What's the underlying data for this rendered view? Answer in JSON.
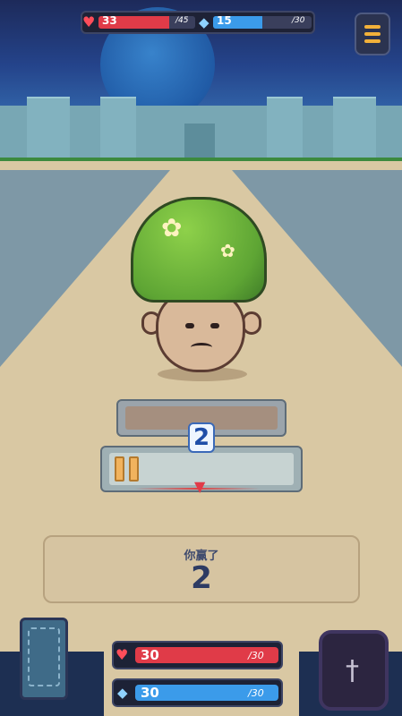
{
  "hud": {
    "hp": {
      "icon": "heart-icon",
      "value": "33",
      "max": "/45",
      "level": 0.733
    },
    "mana": {
      "icon": "gem-icon",
      "value": "15",
      "max": "/30",
      "level": 0.5
    }
  },
  "menu": {
    "icon": "menu-icon"
  },
  "combat": {
    "combo_count": "2",
    "result_label": "你赢了",
    "result_value": "2"
  },
  "player": {
    "hp": {
      "value": "30",
      "max": "/30",
      "level": 1.0
    },
    "mana": {
      "value": "30",
      "max": "/30",
      "level": 1.0
    }
  },
  "dock": {
    "deck_icon": "card-deck-icon",
    "weapon_icon": "sword-icon"
  },
  "colors": {
    "hp": "#e03b48",
    "mana": "#3b9bea",
    "accent": "#f2b13a"
  }
}
